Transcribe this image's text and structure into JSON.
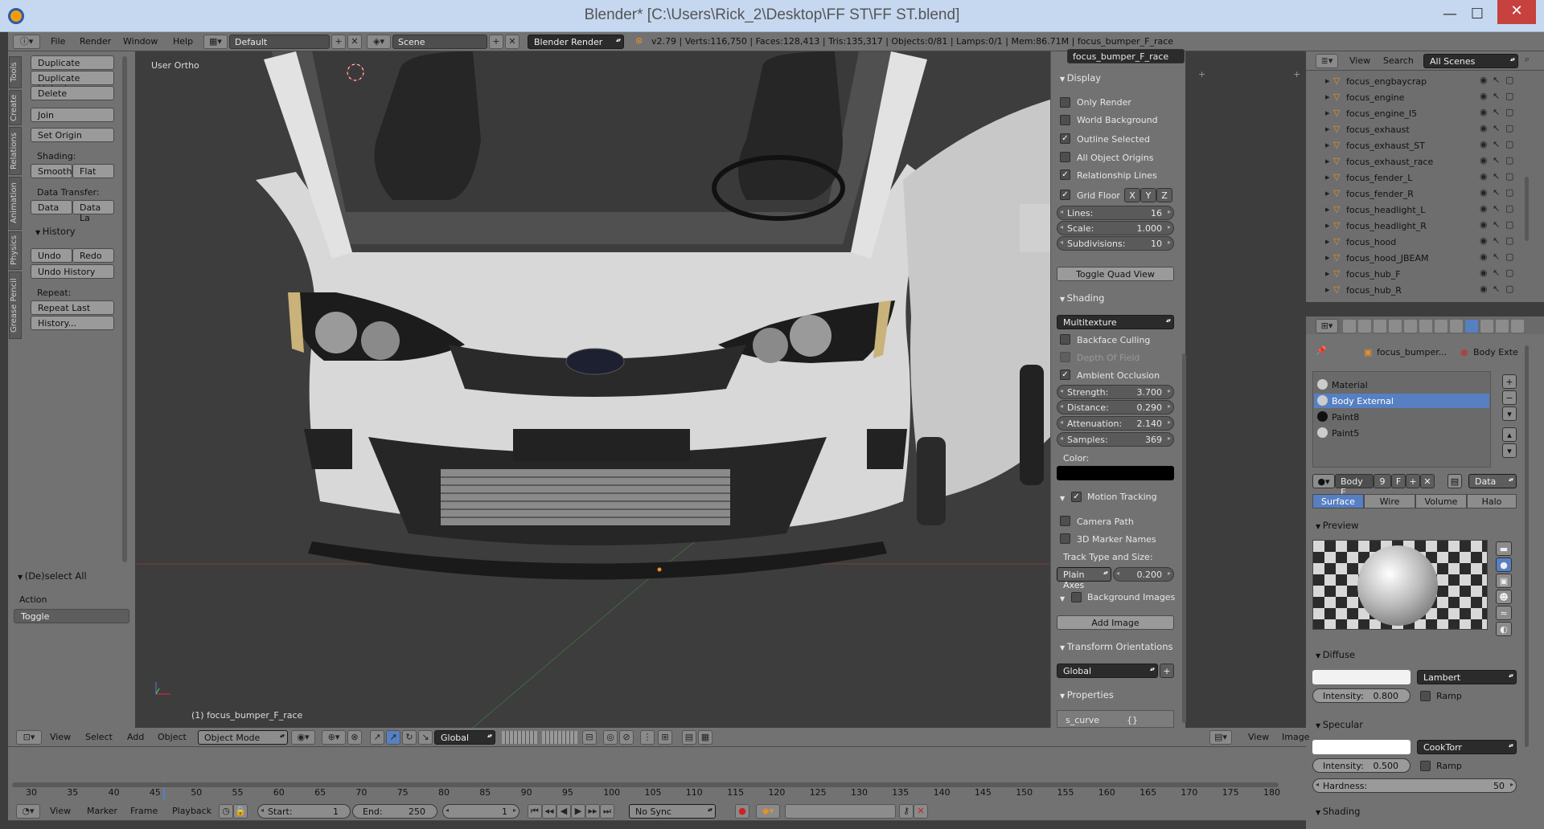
{
  "window": {
    "title": "Blender* [C:\\Users\\Rick_2\\Desktop\\FF ST\\FF ST.blend]",
    "min": "—",
    "max": "☐",
    "close": "✕"
  },
  "info_header": {
    "menus": [
      "File",
      "Render",
      "Window",
      "Help"
    ],
    "layout": "Default",
    "scene": "Scene",
    "engine": "Blender Render",
    "stats": "v2.79 | Verts:116,750 | Faces:128,413 | Tris:135,317 | Objects:0/81 | Lamps:0/1 | Mem:86.71M | focus_bumper_F_race"
  },
  "tool_tabs": [
    "Tools",
    "Create",
    "Relations",
    "Animation",
    "Physics",
    "Grease Pencil"
  ],
  "tools": {
    "duplicate": "Duplicate",
    "duplicate_linked": "Duplicate Linked",
    "delete": "Delete",
    "join": "Join",
    "set_origin": "Set Origin",
    "shading_label": "Shading:",
    "smooth": "Smooth",
    "flat": "Flat",
    "data_transfer_label": "Data Transfer:",
    "data": "Data",
    "data_la": "Data La",
    "history_title": "History",
    "undo": "Undo",
    "redo": "Redo",
    "undo_history": "Undo History",
    "repeat_label": "Repeat:",
    "repeat_last": "Repeat Last",
    "history_btn": "History..."
  },
  "operator": {
    "title": "(De)select All",
    "action_label": "Action",
    "action_value": "Toggle"
  },
  "viewport": {
    "view_name": "User Ortho",
    "object_label": "(1) focus_bumper_F_race"
  },
  "view_header": {
    "menus": [
      "View",
      "Select",
      "Add",
      "Object"
    ],
    "mode": "Object Mode",
    "orientation": "Global"
  },
  "props": {
    "object_name": "focus_bumper_F_race",
    "display": {
      "title": "Display",
      "only_render": "Only Render",
      "world_background": "World Background",
      "outline_selected": "Outline Selected",
      "all_object_origins": "All Object Origins",
      "relationship_lines": "Relationship Lines",
      "grid_floor": "Grid Floor",
      "x": "X",
      "y": "Y",
      "z": "Z",
      "lines_label": "Lines:",
      "lines": "16",
      "scale_label": "Scale:",
      "scale": "1.000",
      "subdiv_label": "Subdivisions:",
      "subdiv": "10",
      "toggle_quad": "Toggle Quad View"
    },
    "shading": {
      "title": "Shading",
      "mode": "Multitexture",
      "backface": "Backface Culling",
      "dof": "Depth Of Field",
      "ao": "Ambient Occlusion",
      "strength_label": "Strength:",
      "strength": "3.700",
      "distance_label": "Distance:",
      "distance": "0.290",
      "atten_label": "Attenuation:",
      "atten": "2.140",
      "samples_label": "Samples:",
      "samples": "369",
      "color_label": "Color:"
    },
    "motion": {
      "title": "Motion Tracking",
      "camera_path": "Camera Path",
      "marker_names": "3D Marker Names",
      "track_label": "Track Type and Size:",
      "track_type": "Plain Axes",
      "track_size": "0.200"
    },
    "bg_images": {
      "title": "Background Images",
      "add": "Add Image"
    },
    "transform_orient": {
      "title": "Transform Orientations",
      "value": "Global"
    },
    "properties": {
      "title": "Properties",
      "item": "s_curve",
      "item_val": "{}"
    }
  },
  "outliner": {
    "menus": [
      "View",
      "Search"
    ],
    "filter": "All Scenes",
    "items": [
      "focus_engbaycrap",
      "focus_engine",
      "focus_engine_I5",
      "focus_exhaust",
      "focus_exhaust_ST",
      "focus_exhaust_race",
      "focus_fender_L",
      "focus_fender_R",
      "focus_headlight_L",
      "focus_headlight_R",
      "focus_hood",
      "focus_hood_JBEAM",
      "focus_hub_F",
      "focus_hub_R"
    ]
  },
  "material": {
    "breadcrumb_obj": "focus_bumper...",
    "breadcrumb_mat": "Body Exte",
    "slots": [
      "Material",
      "Body External",
      "Paint8",
      "Paint5"
    ],
    "selected_slot": 1,
    "mat_name": "Body E",
    "users": "9",
    "fake": "F",
    "data_drop": "Data",
    "tabs": [
      "Surface",
      "Wire",
      "Volume",
      "Halo"
    ],
    "preview": "Preview",
    "diffuse": "Diffuse",
    "diffuse_shader": "Lambert",
    "intensity_label": "Intensity:",
    "diffuse_intensity": "0.800",
    "ramp": "Ramp",
    "specular": "Specular",
    "spec_shader": "CookTorr",
    "spec_intensity": "0.500",
    "hardness_label": "Hardness:",
    "hardness": "50",
    "shading": "Shading"
  },
  "image_header": {
    "menus": [
      "View",
      "Image"
    ]
  },
  "timeline": {
    "ticks": [
      "30",
      "35",
      "40",
      "45",
      "50",
      "55",
      "60",
      "65",
      "70",
      "75",
      "80",
      "85",
      "90",
      "95",
      "100",
      "105",
      "110",
      "115",
      "120",
      "125",
      "130",
      "135",
      "140",
      "145",
      "150",
      "155",
      "160",
      "165",
      "170",
      "175",
      "180"
    ],
    "menus": [
      "View",
      "Marker",
      "Frame",
      "Playback"
    ],
    "start_label": "Start:",
    "start": "1",
    "end_label": "End:",
    "end": "250",
    "current": "1",
    "sync": "No Sync"
  },
  "colors": {
    "accent": "#5680c2",
    "bg": "#3d3d3d",
    "panel": "#727272",
    "selected_row": "#5680c2"
  }
}
